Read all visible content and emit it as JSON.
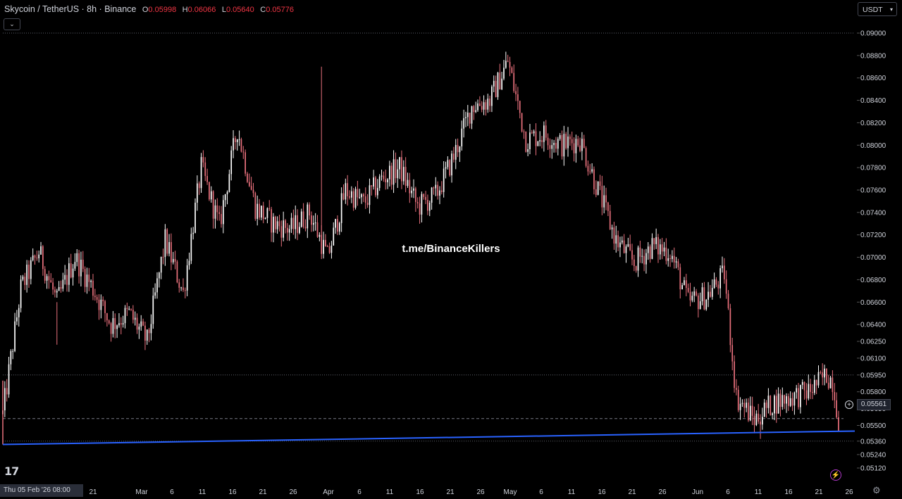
{
  "header": {
    "symbol": "Skycoin / TetherUS · 8h · Binance",
    "o_label": "O",
    "o_value": "0.05998",
    "h_label": "H",
    "h_value": "0.06066",
    "l_label": "L",
    "l_value": "0.05640",
    "c_label": "C",
    "c_value": "0.05776"
  },
  "currency_label": "USDT",
  "watermark": "t.me/BinanceKillers",
  "logo_text": "17",
  "date_chip": "Thu 05 Feb '26  08:00",
  "current_price_label": "0.05561",
  "colors": {
    "up": "#ffffff",
    "down": "#e8707c",
    "trendline": "#2962ff",
    "background": "#000000",
    "accent_purple": "#b039c8"
  },
  "chart_data": {
    "type": "candlestick",
    "y_ticks": [
      "0.09000",
      "0.08800",
      "0.08600",
      "0.08400",
      "0.08200",
      "0.08000",
      "0.07800",
      "0.07600",
      "0.07400",
      "0.07200",
      "0.07000",
      "0.06800",
      "0.06600",
      "0.06400",
      "0.06250",
      "0.06100",
      "0.05950",
      "0.05800",
      "0.05650",
      "0.05500",
      "0.05360",
      "0.05240",
      "0.05120"
    ],
    "x_ticks": [
      "21",
      "Mar",
      "6",
      "11",
      "16",
      "21",
      "26",
      "Apr",
      "6",
      "11",
      "16",
      "21",
      "26",
      "May",
      "6",
      "11",
      "16",
      "21",
      "26",
      "Jun",
      "6",
      "11",
      "16",
      "21",
      "26"
    ],
    "current_price": 0.05561,
    "dotted_levels": [
      0.09,
      0.0595,
      0.0536
    ],
    "trendline": {
      "from": {
        "date": "2026-02-05",
        "price": 0.0533
      },
      "to": {
        "date": "2026-06-25",
        "price": 0.0545
      }
    },
    "close_path": [
      {
        "date": "2026-02-05",
        "close": 0.056
      },
      {
        "date": "2026-02-08",
        "close": 0.0672
      },
      {
        "date": "2026-02-11",
        "close": 0.0705
      },
      {
        "date": "2026-02-14",
        "close": 0.066
      },
      {
        "date": "2026-02-17",
        "close": 0.07
      },
      {
        "date": "2026-02-20",
        "close": 0.0672
      },
      {
        "date": "2026-02-23",
        "close": 0.064
      },
      {
        "date": "2026-02-26",
        "close": 0.065
      },
      {
        "date": "2026-03-01",
        "close": 0.0625
      },
      {
        "date": "2026-03-04",
        "close": 0.0715
      },
      {
        "date": "2026-03-07",
        "close": 0.0668
      },
      {
        "date": "2026-03-10",
        "close": 0.078
      },
      {
        "date": "2026-03-13",
        "close": 0.0728
      },
      {
        "date": "2026-03-16",
        "close": 0.0815
      },
      {
        "date": "2026-03-19",
        "close": 0.0745
      },
      {
        "date": "2026-03-22",
        "close": 0.073
      },
      {
        "date": "2026-03-25",
        "close": 0.0725
      },
      {
        "date": "2026-03-28",
        "close": 0.074
      },
      {
        "date": "2026-03-31",
        "close": 0.07
      },
      {
        "date": "2026-04-03",
        "close": 0.076
      },
      {
        "date": "2026-04-06",
        "close": 0.0748
      },
      {
        "date": "2026-04-09",
        "close": 0.077
      },
      {
        "date": "2026-04-12",
        "close": 0.078
      },
      {
        "date": "2026-04-15",
        "close": 0.0745
      },
      {
        "date": "2026-04-18",
        "close": 0.0755
      },
      {
        "date": "2026-04-21",
        "close": 0.079
      },
      {
        "date": "2026-04-24",
        "close": 0.0835
      },
      {
        "date": "2026-04-27",
        "close": 0.084
      },
      {
        "date": "2026-04-30",
        "close": 0.0875
      },
      {
        "date": "2026-05-03",
        "close": 0.0805
      },
      {
        "date": "2026-05-06",
        "close": 0.081
      },
      {
        "date": "2026-05-09",
        "close": 0.08
      },
      {
        "date": "2026-05-12",
        "close": 0.0805
      },
      {
        "date": "2026-05-15",
        "close": 0.076
      },
      {
        "date": "2026-05-18",
        "close": 0.0715
      },
      {
        "date": "2026-05-21",
        "close": 0.0695
      },
      {
        "date": "2026-05-24",
        "close": 0.071
      },
      {
        "date": "2026-05-27",
        "close": 0.0705
      },
      {
        "date": "2026-05-30",
        "close": 0.066
      },
      {
        "date": "2026-06-02",
        "close": 0.0665
      },
      {
        "date": "2026-06-05",
        "close": 0.0685
      },
      {
        "date": "2026-06-07",
        "close": 0.0575
      },
      {
        "date": "2026-06-10",
        "close": 0.0555
      },
      {
        "date": "2026-06-13",
        "close": 0.057
      },
      {
        "date": "2026-06-16",
        "close": 0.0575
      },
      {
        "date": "2026-06-19",
        "close": 0.058
      },
      {
        "date": "2026-06-22",
        "close": 0.0595
      },
      {
        "date": "2026-06-23",
        "close": 0.059
      },
      {
        "date": "2026-06-24",
        "close": 0.0556
      }
    ],
    "spikes": [
      {
        "date": "2026-03-30",
        "high": 0.087
      },
      {
        "date": "2026-02-14",
        "low": 0.0622
      },
      {
        "date": "2026-06-11",
        "low": 0.0538
      }
    ]
  }
}
